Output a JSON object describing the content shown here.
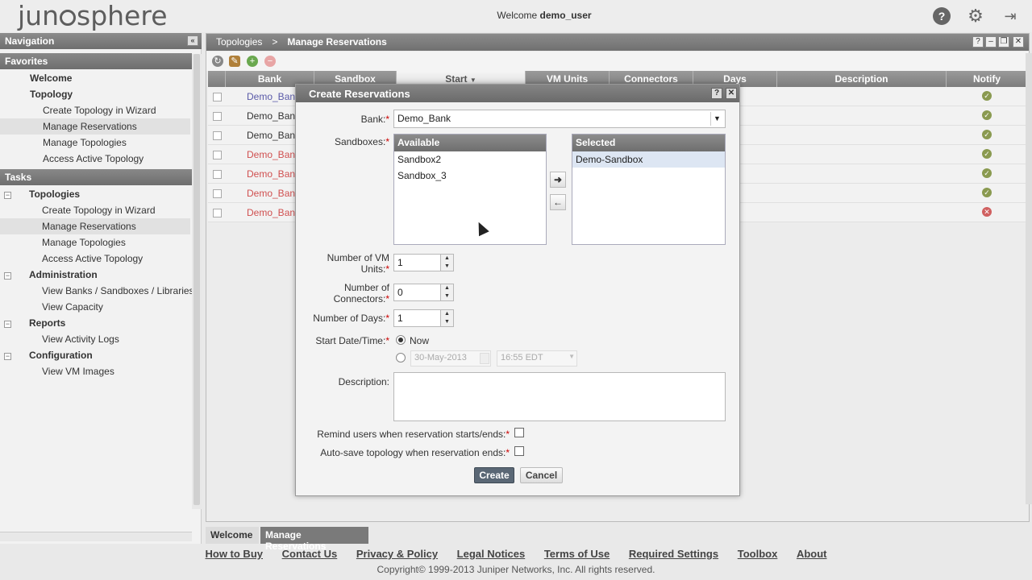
{
  "header": {
    "logo_text": "jun sphere",
    "welcome_prefix": "Welcome",
    "welcome_user": "demo_user"
  },
  "left_nav": {
    "navigation_title": "Navigation",
    "favorites_title": "Favorites",
    "favorites": [
      {
        "label": "Welcome",
        "bold": true
      },
      {
        "label": "Topology",
        "bold": true
      },
      {
        "label": "Create Topology in Wizard"
      },
      {
        "label": "Manage Reservations",
        "selected": true
      },
      {
        "label": "Manage Topologies"
      },
      {
        "label": "Access Active Topology"
      }
    ],
    "tasks_title": "Tasks",
    "tasks": [
      {
        "label": "Topologies",
        "bold": true,
        "group": true
      },
      {
        "label": "Create Topology in Wizard"
      },
      {
        "label": "Manage Reservations",
        "selected": true
      },
      {
        "label": "Manage Topologies"
      },
      {
        "label": "Access Active Topology"
      },
      {
        "label": "Administration",
        "bold": true,
        "group": true
      },
      {
        "label": "View Banks / Sandboxes / Libraries"
      },
      {
        "label": "View Capacity"
      },
      {
        "label": "Reports",
        "bold": true,
        "group": true
      },
      {
        "label": "View Activity Logs"
      },
      {
        "label": "Configuration",
        "bold": true,
        "group": true
      },
      {
        "label": "View VM Images"
      }
    ]
  },
  "main": {
    "breadcrumb": {
      "root": "Topologies",
      "separator": ">",
      "current": "Manage Reservations"
    },
    "columns": [
      "Bank",
      "Sandbox",
      "Start",
      "VM Units",
      "Connectors",
      "Days",
      "Description",
      "Notify"
    ],
    "sort_indicator": "▼",
    "rows": [
      {
        "bank": "Demo_Bank",
        "color": "#5a5aa8",
        "notify": "ok"
      },
      {
        "bank": "Demo_Bank",
        "color": "#333333",
        "notify": "ok"
      },
      {
        "bank": "Demo_Bank",
        "color": "#333333",
        "notify": "ok"
      },
      {
        "bank": "Demo_Bank",
        "color": "#d05050",
        "notify": "ok"
      },
      {
        "bank": "Demo_Bank",
        "color": "#d05050",
        "notify": "ok"
      },
      {
        "bank": "Demo_Bank",
        "color": "#d05050",
        "notify": "ok"
      },
      {
        "bank": "Demo_Bank",
        "color": "#d05050",
        "notify": "error"
      }
    ]
  },
  "bottom_tabs": [
    {
      "label": "Welcome",
      "active": false
    },
    {
      "label": "Manage Reservations",
      "active": true
    }
  ],
  "footer": {
    "links": [
      "How to Buy",
      "Contact Us",
      "Privacy & Policy",
      "Legal Notices",
      "Terms of Use",
      "Required Settings",
      "Toolbox",
      "About"
    ],
    "copyright": "Copyright© 1999-2013 Juniper Networks, Inc. All rights reserved."
  },
  "dialog": {
    "title": "Create Reservations",
    "help_btn": "?",
    "close_btn": "✕",
    "bank_label": "Bank:",
    "bank_value": "Demo_Bank",
    "sandboxes_label": "Sandboxes:",
    "available_title": "Available",
    "available": [
      "Sandbox2",
      "Sandbox_3"
    ],
    "selected_title": "Selected",
    "selected": [
      "Demo-Sandbox"
    ],
    "vm_units_label_1": "Number of VM",
    "vm_units_label_2": "Units:",
    "vm_units_value": "1",
    "connectors_label_1": "Number of",
    "connectors_label_2": "Connectors:",
    "connectors_value": "0",
    "days_label": "Number of Days:",
    "days_value": "1",
    "start_label": "Start Date/Time:",
    "start_now": "Now",
    "start_date": "30-May-2013",
    "start_time": "16:55 EDT",
    "description_label": "Description:",
    "description_value": "",
    "remind_label": "Remind users when reservation starts/ends:",
    "autosave_label": "Auto-save topology when reservation ends:",
    "create_btn": "Create",
    "cancel_btn": "Cancel"
  },
  "colors": {
    "accent": "#5a6775",
    "ok": "#8a9a50",
    "error": "#d06060"
  }
}
